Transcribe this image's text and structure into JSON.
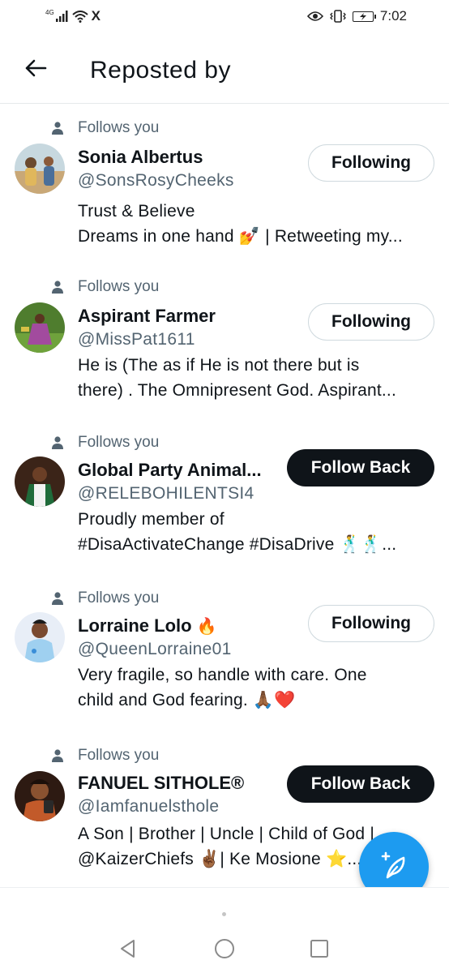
{
  "status_bar": {
    "network": "4G",
    "carrier_icon": "X",
    "time": "7:02",
    "icons": [
      "signal-icon",
      "wifi-icon",
      "x-logo-icon",
      "eye-icon",
      "vibrate-icon",
      "battery-icon"
    ]
  },
  "header": {
    "title": "Reposted by",
    "back_icon": "arrow-left-icon"
  },
  "users": [
    {
      "context": "Follows you",
      "name": "Sonia Albertus",
      "name_emoji": "",
      "handle": "@SonsRosyCheeks",
      "bio": [
        "Trust & Believe",
        "Dreams in one hand 💅 | Retweeting my..."
      ],
      "button": "Following",
      "button_type": "following"
    },
    {
      "context": "Follows you",
      "name": "Aspirant Farmer",
      "name_emoji": "",
      "handle": "@MissPat1611",
      "bio": [
        "He is (The as if He is not there but is",
        "there) . The Omnipresent God. Aspirant..."
      ],
      "button": "Following",
      "button_type": "following"
    },
    {
      "context": "Follows you",
      "name": "Global Party Animal...",
      "name_emoji": "",
      "handle": "@RELEBOHILENTSI4",
      "bio": [
        "Proudly member of",
        "#DisaActivateChange #DisaDrive 🕺🕺..."
      ],
      "button": "Follow Back",
      "button_type": "follow-back"
    },
    {
      "context": "Follows you",
      "name": "Lorraine Lolo",
      "name_emoji": "🔥",
      "handle": "@QueenLorraine01",
      "bio": [
        "Very fragile, so handle with care. One",
        "child and God fearing. 🙏🏾❤️"
      ],
      "button": "Following",
      "button_type": "following"
    },
    {
      "context": "Follows you",
      "name": "FANUEL SITHOLE®",
      "name_emoji": "",
      "handle": "@Iamfanuelsthole",
      "bio": [
        "A Son | Brother | Uncle | Child of God |",
        "@KaizerChiefs ✌🏾| Ke Mosione ⭐..."
      ],
      "button": "Follow Back",
      "button_type": "follow-back"
    }
  ],
  "fab": {
    "icon": "compose-post-icon"
  },
  "nav_bar": {
    "icons": [
      "back-triangle-icon",
      "home-circle-icon",
      "recents-square-icon"
    ]
  },
  "colors": {
    "accent": "#1d9bf0",
    "text_primary": "#0f1419",
    "text_secondary": "#536471",
    "border": "#cfd9de",
    "follow_back_bg": "#0f1419"
  }
}
